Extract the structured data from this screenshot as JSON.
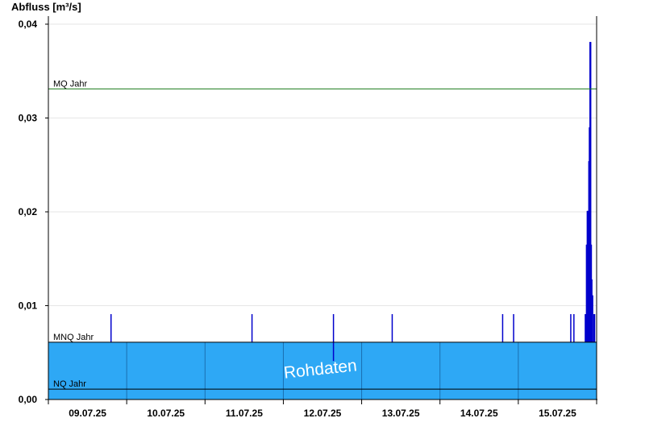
{
  "chart_data": {
    "type": "area",
    "title": "Abfluss [m³/s]",
    "ylim": [
      0,
      0.04
    ],
    "y_ticks": [
      {
        "value": 0.0,
        "label": "0,00"
      },
      {
        "value": 0.01,
        "label": "0,01"
      },
      {
        "value": 0.02,
        "label": "0,02"
      },
      {
        "value": 0.03,
        "label": "0,03"
      },
      {
        "value": 0.04,
        "label": "0,04"
      }
    ],
    "x_range_days": [
      0,
      7
    ],
    "x_ticks": [
      "09.07.25",
      "10.07.25",
      "11.07.25",
      "12.07.25",
      "13.07.25",
      "14.07.25",
      "15.07.25"
    ],
    "grid": true,
    "reference_lines": [
      {
        "name": "MQ Jahr",
        "value": 0.0331,
        "color": "#1a7a1a"
      },
      {
        "name": "MNQ Jahr",
        "value": 0.0061,
        "color": "#000000"
      },
      {
        "name": "NQ Jahr",
        "value": 0.0011,
        "color": "#000000"
      }
    ],
    "series": [
      {
        "baseline": 0.0061,
        "color": "#0000cc",
        "fill": "#2ea8f5",
        "points": [
          {
            "x": 0.8,
            "y": 0.0091
          },
          {
            "x": 2.6,
            "y": 0.0091
          },
          {
            "x": 3.64,
            "y": 0.0091
          },
          {
            "x": 3.64,
            "y": 0.0041
          },
          {
            "x": 4.39,
            "y": 0.0091
          },
          {
            "x": 5.8,
            "y": 0.0091
          },
          {
            "x": 5.94,
            "y": 0.0091
          },
          {
            "x": 6.67,
            "y": 0.0091
          },
          {
            "x": 6.71,
            "y": 0.0091
          },
          {
            "x": 6.86,
            "y": 0.0091
          },
          {
            "x": 6.875,
            "y": 0.0165
          },
          {
            "x": 6.885,
            "y": 0.0201
          },
          {
            "x": 6.9,
            "y": 0.0165
          },
          {
            "x": 6.905,
            "y": 0.0254
          },
          {
            "x": 6.912,
            "y": 0.029
          },
          {
            "x": 6.92,
            "y": 0.0381
          },
          {
            "x": 6.928,
            "y": 0.0165
          },
          {
            "x": 6.935,
            "y": 0.0128
          },
          {
            "x": 6.945,
            "y": 0.0111
          },
          {
            "x": 6.97,
            "y": 0.0091
          }
        ]
      }
    ],
    "watermark": "Rohdaten"
  }
}
